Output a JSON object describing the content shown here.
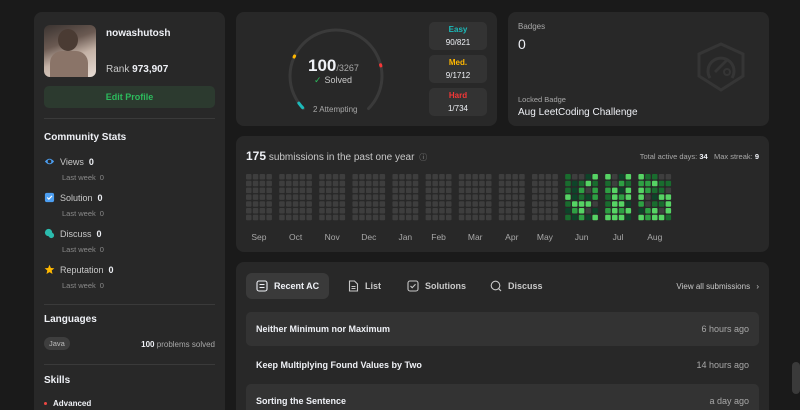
{
  "profile": {
    "username": "nowashutosh",
    "rank_label": "Rank",
    "rank_value": "973,907",
    "edit_label": "Edit Profile"
  },
  "community": {
    "title": "Community Stats",
    "items": [
      {
        "label": "Views",
        "value": "0",
        "sub_label": "Last week",
        "sub_value": "0"
      },
      {
        "label": "Solution",
        "value": "0",
        "sub_label": "Last week",
        "sub_value": "0"
      },
      {
        "label": "Discuss",
        "value": "0",
        "sub_label": "Last week",
        "sub_value": "0"
      },
      {
        "label": "Reputation",
        "value": "0",
        "sub_label": "Last week",
        "sub_value": "0"
      }
    ],
    "colors": {
      "views": "#4c9ef1",
      "solution": "#4c9ef1",
      "discuss": "#2bbbad",
      "reputation": "#ffb800"
    }
  },
  "languages": {
    "title": "Languages",
    "items": [
      {
        "name": "Java",
        "count": "100",
        "suffix": "problems solved"
      }
    ]
  },
  "skills": {
    "title": "Skills",
    "items": [
      {
        "level": "Advanced"
      }
    ]
  },
  "solved": {
    "count": "100",
    "total": "/3267",
    "label": "Solved",
    "attempting": "2 Attempting",
    "difficulty": [
      {
        "name": "Easy",
        "value": "90/821",
        "color": "#1cbaba",
        "solved": 90,
        "total": 821
      },
      {
        "name": "Med.",
        "value": "9/1712",
        "color": "#ffb700",
        "solved": 9,
        "total": 1712
      },
      {
        "name": "Hard",
        "value": "1/734",
        "color": "#f63737",
        "solved": 1,
        "total": 734
      }
    ]
  },
  "badges": {
    "label": "Badges",
    "count": "0",
    "locked_label": "Locked Badge",
    "locked_name": "Aug LeetCoding Challenge"
  },
  "heatmap": {
    "count": "175",
    "text": "submissions in the past one year",
    "active_label": "Total active days:",
    "active_days": "34",
    "streak_label": "Max streak:",
    "streak": "9",
    "months": [
      "Sep",
      "Oct",
      "Nov",
      "Dec",
      "Jan",
      "Feb",
      "Mar",
      "Apr",
      "May",
      "Jun",
      "Jul",
      "Aug"
    ],
    "colors": {
      "empty": "#3e3e3e",
      "low": "#0e4429",
      "mid": "#196c2e",
      "high": "#2ea043",
      "top": "#56d364"
    }
  },
  "tabs": {
    "items": [
      {
        "label": "Recent AC",
        "active": true
      },
      {
        "label": "List"
      },
      {
        "label": "Solutions"
      },
      {
        "label": "Discuss"
      }
    ],
    "view_all": "View all submissions"
  },
  "submissions": [
    {
      "title": "Neither Minimum nor Maximum",
      "time": "6 hours ago"
    },
    {
      "title": "Keep Multiplying Found Values by Two",
      "time": "14 hours ago"
    },
    {
      "title": "Sorting the Sentence",
      "time": "a day ago"
    }
  ]
}
